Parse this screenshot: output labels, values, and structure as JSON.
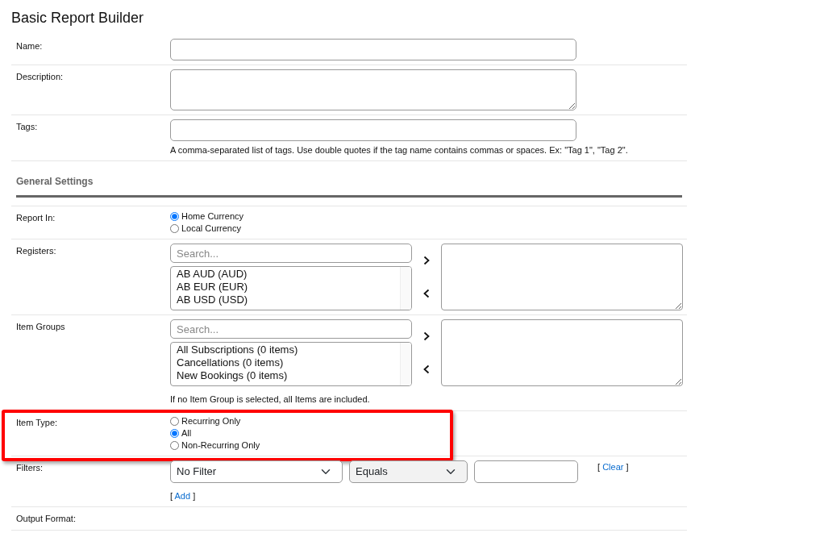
{
  "title": "Basic Report Builder",
  "rows": [
    {
      "kind": "text",
      "label": "Name:"
    },
    {
      "kind": "textarea",
      "label": "Description:"
    },
    {
      "kind": "text",
      "label": "Tags:",
      "help": "A comma-separated list of tags. Use double quotes if the tag name contains commas or spaces. Ex: \"Tag 1\", \"Tag 2\"."
    },
    {
      "kind": "section",
      "label": "General Settings"
    },
    {
      "kind": "radio",
      "label": "Report In:",
      "options": [
        {
          "label": "Home Currency",
          "selected": true
        },
        {
          "label": "Local Currency",
          "selected": false
        }
      ]
    },
    {
      "kind": "duallist",
      "label": "Registers:",
      "placeholder": "Search...",
      "items": [
        "AB AUD (AUD)",
        "AB EUR (EUR)",
        "AB USD (USD)"
      ]
    },
    {
      "kind": "duallist",
      "label": "Item Groups",
      "placeholder": "Search...",
      "items": [
        "All Subscriptions (0 items)",
        "Cancellations (0 items)",
        "New Bookings (0 items)"
      ],
      "help": "If no Item Group is selected, all Items are included."
    },
    {
      "kind": "radio",
      "label": "Item Type:",
      "highlighted": true,
      "options": [
        {
          "label": "Recurring Only",
          "selected": false
        },
        {
          "label": "All",
          "selected": true
        },
        {
          "label": "Non-Recurring Only",
          "selected": false
        }
      ]
    },
    {
      "kind": "filters",
      "label": "Filters:",
      "field": "No Filter",
      "operator": "Equals",
      "clear": {
        "open": "[",
        "text": "Clear",
        "close": "]"
      },
      "add": {
        "open": "[",
        "text": "Add",
        "close": "]"
      }
    },
    {
      "kind": "label",
      "label": "Output Format:"
    }
  ]
}
